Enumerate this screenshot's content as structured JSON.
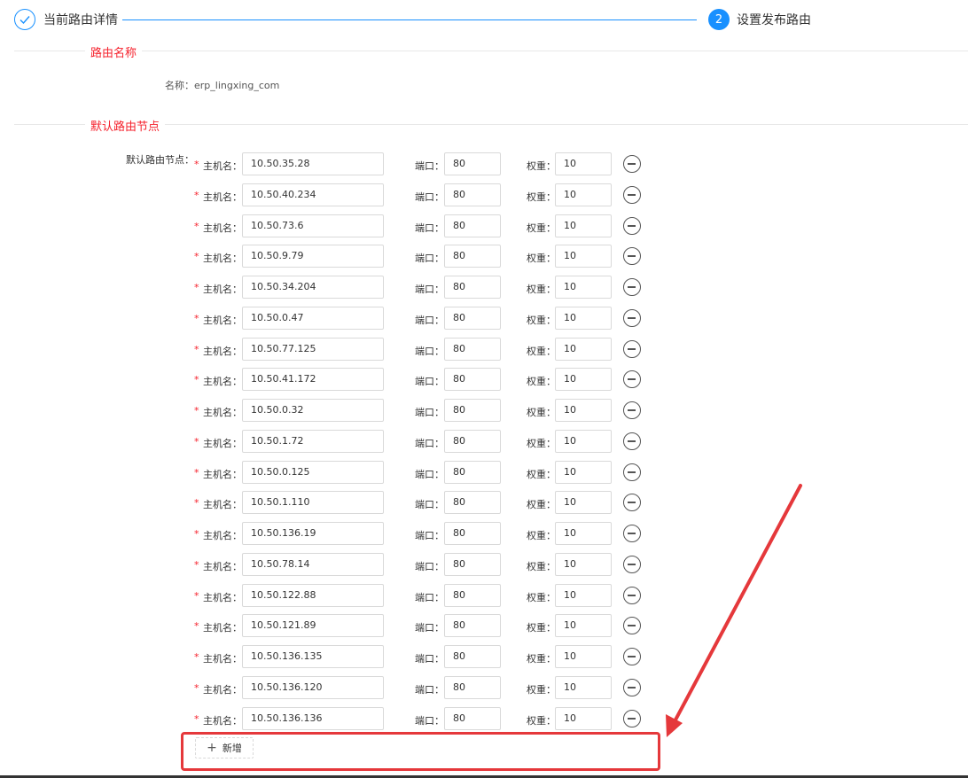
{
  "steps": [
    {
      "label": "当前路由详情",
      "icon": "check-icon",
      "state": "done"
    },
    {
      "label": "设置发布路由",
      "number": "2",
      "state": "active"
    }
  ],
  "route_name_section": {
    "title": "路由名称",
    "name_label": "名称：",
    "name_value": "erp_lingxing_com"
  },
  "nodes_section": {
    "title": "默认路由节点",
    "field_label": "默认路由节点：",
    "host_label": "主机名：",
    "port_label": "端口：",
    "weight_label": "权重：",
    "rows": [
      {
        "host": "10.50.35.28",
        "port": "80",
        "weight": "10"
      },
      {
        "host": "10.50.40.234",
        "port": "80",
        "weight": "10"
      },
      {
        "host": "10.50.73.6",
        "port": "80",
        "weight": "10"
      },
      {
        "host": "10.50.9.79",
        "port": "80",
        "weight": "10"
      },
      {
        "host": "10.50.34.204",
        "port": "80",
        "weight": "10"
      },
      {
        "host": "10.50.0.47",
        "port": "80",
        "weight": "10"
      },
      {
        "host": "10.50.77.125",
        "port": "80",
        "weight": "10"
      },
      {
        "host": "10.50.41.172",
        "port": "80",
        "weight": "10"
      },
      {
        "host": "10.50.0.32",
        "port": "80",
        "weight": "10"
      },
      {
        "host": "10.50.1.72",
        "port": "80",
        "weight": "10"
      },
      {
        "host": "10.50.0.125",
        "port": "80",
        "weight": "10"
      },
      {
        "host": "10.50.1.110",
        "port": "80",
        "weight": "10"
      },
      {
        "host": "10.50.136.19",
        "port": "80",
        "weight": "10"
      },
      {
        "host": "10.50.78.14",
        "port": "80",
        "weight": "10"
      },
      {
        "host": "10.50.122.88",
        "port": "80",
        "weight": "10"
      },
      {
        "host": "10.50.121.89",
        "port": "80",
        "weight": "10"
      },
      {
        "host": "10.50.136.135",
        "port": "80",
        "weight": "10"
      },
      {
        "host": "10.50.136.120",
        "port": "80",
        "weight": "10"
      },
      {
        "host": "10.50.136.136",
        "port": "80",
        "weight": "10"
      }
    ],
    "add_button_label": "新增"
  },
  "colors": {
    "primary": "#1890ff",
    "section_title": "#f5222d",
    "annotation": "#e5383b"
  }
}
